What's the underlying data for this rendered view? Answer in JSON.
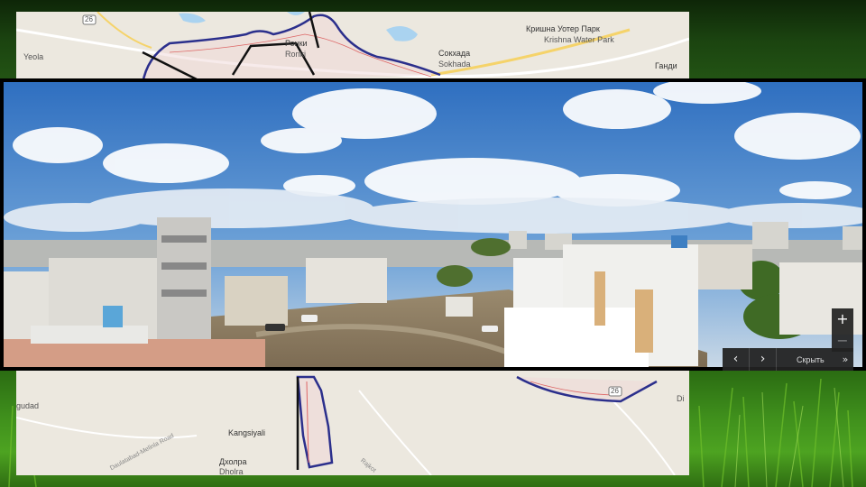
{
  "map": {
    "labels": {
      "route_badge_top": "26",
      "route_badge_bottom": "26",
      "yeola": "Yeola",
      "krishna_water_park_ru": "Кришна Уотер Парк",
      "krishna_water_park": "Krishna Water Park",
      "sokhada_ru": "Сокхада",
      "sokhada": "Sokhada",
      "roneti_ru": "Ронки",
      "roneti": "Ronki",
      "gandhi_ru": "Ганди",
      "gudad": "gudad",
      "kangsiyali": "Kangsiyali",
      "dholra_ru": "Дхолра",
      "dholra": "Dholra",
      "road_left": "Daulatabad-Melinla Road",
      "road_right": "Rajkot",
      "di": "Di"
    },
    "colors": {
      "boundary": "#2b2f8c",
      "line": "#111111",
      "highway": "#f5d36a",
      "water": "#aad3f0"
    }
  },
  "streetview": {
    "zoom_in": "+",
    "zoom_out": "−",
    "prev": "‹",
    "next": "›",
    "hide_label": "Скрыть",
    "hide_chevron": "»"
  }
}
